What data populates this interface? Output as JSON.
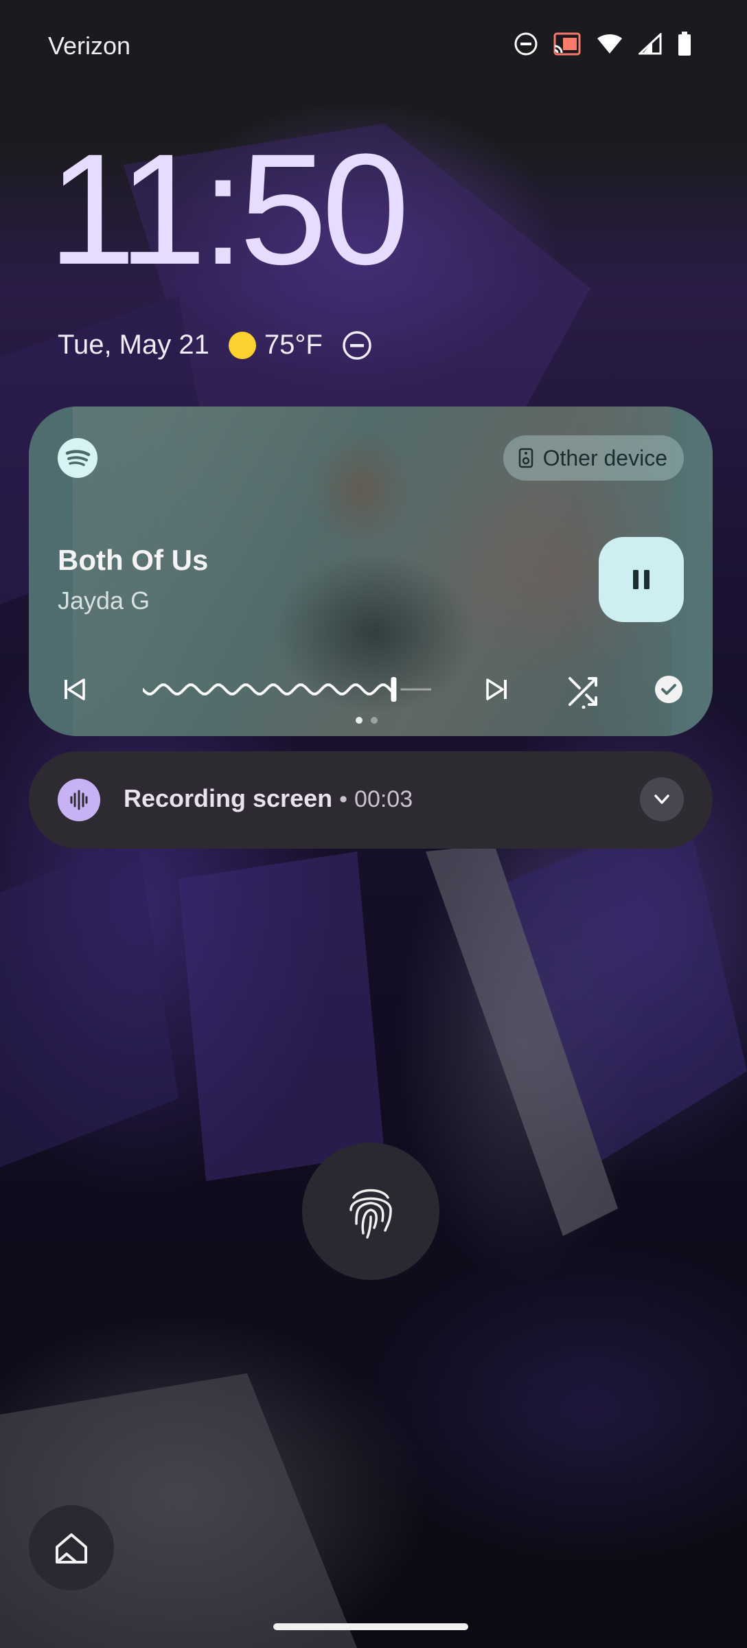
{
  "status_bar": {
    "carrier": "Verizon",
    "icons": [
      "do-not-disturb-icon",
      "cast-icon",
      "wifi-icon",
      "signal-icon",
      "battery-icon"
    ]
  },
  "lockscreen": {
    "time": "11:50",
    "date": "Tue, May 21",
    "temperature": "75°F",
    "weather_icon": "sunny-icon",
    "dnd_icon": "do-not-disturb-icon"
  },
  "media": {
    "app_icon": "spotify-icon",
    "output_device": "Other device",
    "title": "Both Of Us",
    "artist": "Jayda G",
    "progress": 0.87,
    "page_count": 2,
    "current_page": 1,
    "controls": [
      "previous-icon",
      "pause-icon",
      "next-icon",
      "shuffle-icon",
      "queue-check-icon"
    ],
    "accent_color": "#cdeff2"
  },
  "notification": {
    "title": "Recording screen",
    "separator": "•",
    "elapsed": "00:03",
    "icon": "sound-wave-icon",
    "icon_color": "#c7b2f4"
  },
  "unlock": {
    "icon": "fingerprint-icon"
  },
  "shortcut": {
    "icon": "home-icon"
  }
}
